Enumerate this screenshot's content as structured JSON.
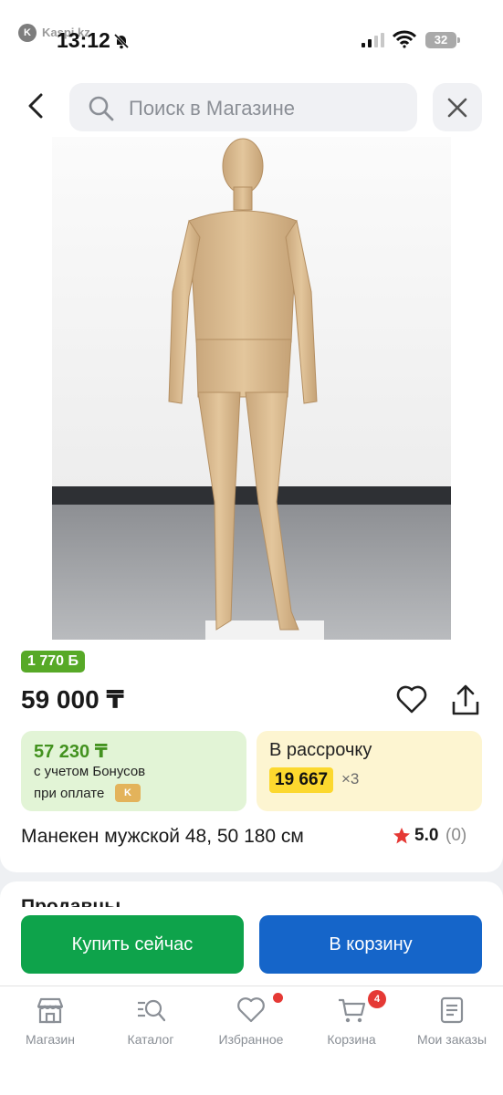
{
  "status_bar": {
    "back_app_label": "Kaspi.kz",
    "time": "13:12",
    "battery": "32"
  },
  "header": {
    "search_placeholder": "Поиск в Магазине"
  },
  "product": {
    "bonus_badge": "1 770 Б",
    "price": "59 000 ₸",
    "bonus_price": "57 230 ₸",
    "bonus_line1": "с учетом Бонусов",
    "bonus_line2": "при оплате",
    "installment_title": "В рассрочку",
    "installment_amount": "19 667",
    "installment_months": "×3",
    "title": "Манекен мужской 48, 50 180 см",
    "rating": "5.0",
    "reviews": "(0)"
  },
  "sellers": {
    "title": "Продавцы"
  },
  "actions": {
    "buy_now": "Купить сейчас",
    "add_to_cart": "В корзину"
  },
  "bottom_nav": {
    "items": [
      {
        "label": "Магазин",
        "icon": "store-icon"
      },
      {
        "label": "Каталог",
        "icon": "catalog-icon"
      },
      {
        "label": "Избранное",
        "icon": "heart-icon"
      },
      {
        "label": "Корзина",
        "icon": "cart-icon",
        "badge": "4"
      },
      {
        "label": "Мои заказы",
        "icon": "orders-icon"
      }
    ]
  },
  "colors": {
    "bonus_green": "#57a927",
    "buy_green": "#0ea34b",
    "cart_blue": "#1565c9",
    "installment_yellow": "#fcd82e",
    "badge_red": "#e53935"
  }
}
